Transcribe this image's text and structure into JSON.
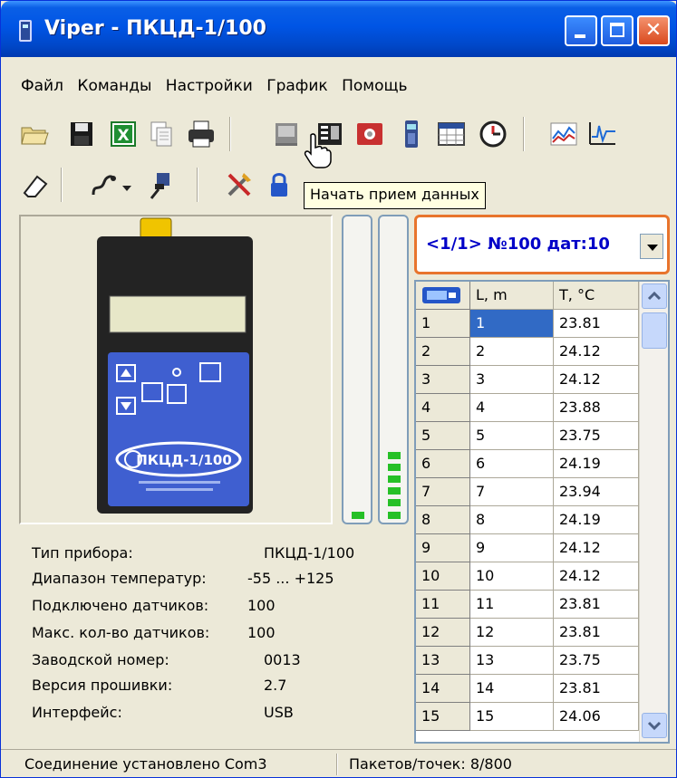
{
  "window": {
    "title": "Viper - ПКЦД-1/100"
  },
  "menu": [
    "Файл",
    "Команды",
    "Настройки",
    "График",
    "Помощь"
  ],
  "tooltip": "Начать прием данных",
  "selector": {
    "value": "<1/1> №100 дат:10"
  },
  "info": [
    {
      "label": "Тип прибора:",
      "value": "ПКЦД-1/100"
    },
    {
      "label": "Диапазон температур:",
      "value": "-55 ... +125"
    },
    {
      "label": "Подключено датчиков:",
      "value": "100"
    },
    {
      "label": "Макс. кол-во датчиков:",
      "value": "100"
    },
    {
      "label": "Заводской номер:",
      "value": "0013"
    },
    {
      "label": "Версия прошивки:",
      "value": "2.7"
    },
    {
      "label": "Интерфейс:",
      "value": "USB"
    }
  ],
  "device": {
    "model": "ПКЦД-1/100"
  },
  "grid": {
    "columns": [
      "L, m",
      "T, °C"
    ],
    "rows": [
      {
        "n": "1",
        "l": "1",
        "t": "23.81"
      },
      {
        "n": "2",
        "l": "2",
        "t": "24.12"
      },
      {
        "n": "3",
        "l": "3",
        "t": "24.12"
      },
      {
        "n": "4",
        "l": "4",
        "t": "23.88"
      },
      {
        "n": "5",
        "l": "5",
        "t": "23.75"
      },
      {
        "n": "6",
        "l": "6",
        "t": "24.19"
      },
      {
        "n": "7",
        "l": "7",
        "t": "23.94"
      },
      {
        "n": "8",
        "l": "8",
        "t": "24.19"
      },
      {
        "n": "9",
        "l": "9",
        "t": "24.12"
      },
      {
        "n": "10",
        "l": "10",
        "t": "24.12"
      },
      {
        "n": "11",
        "l": "11",
        "t": "23.81"
      },
      {
        "n": "12",
        "l": "12",
        "t": "23.81"
      },
      {
        "n": "13",
        "l": "13",
        "t": "23.75"
      },
      {
        "n": "14",
        "l": "14",
        "t": "23.81"
      },
      {
        "n": "15",
        "l": "15",
        "t": "24.06"
      }
    ]
  },
  "status": {
    "connection": "Соединение установлено Com3",
    "packets": "Пакетов/точек: 8/800"
  },
  "colors": {
    "title_blue": "#0055e5",
    "accent_orange": "#e8742c",
    "selector_text": "#0000c8",
    "level_green": "#26c026",
    "device_panel_blue": "#3f5fd0"
  }
}
